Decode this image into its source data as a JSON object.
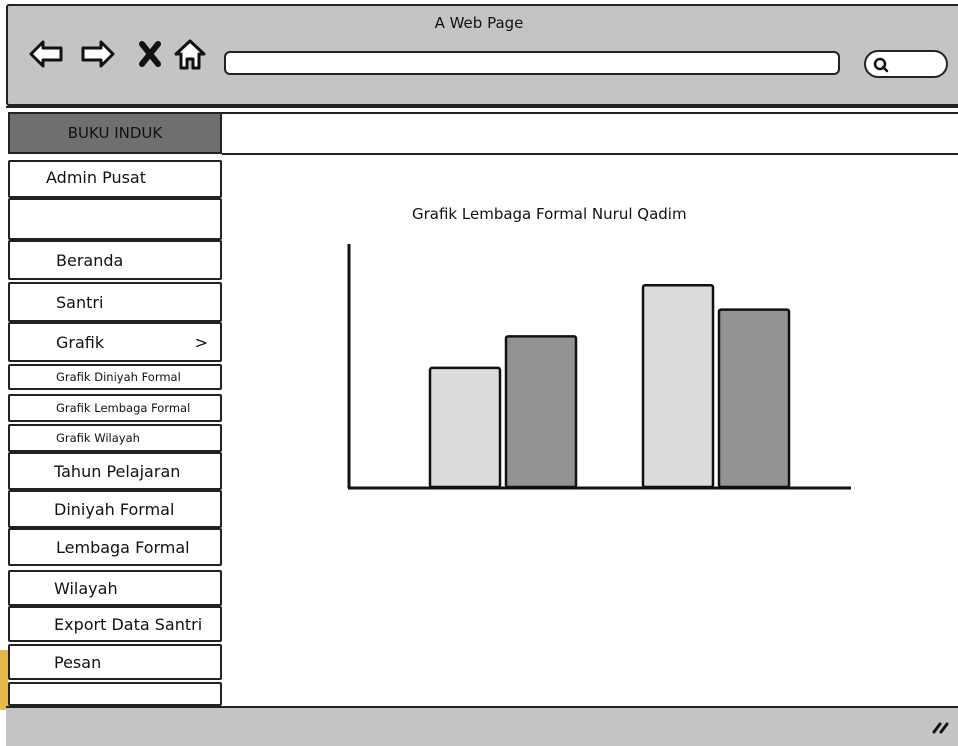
{
  "browser": {
    "title": "A Web Page",
    "nav_icons": [
      "back-arrow-icon",
      "forward-arrow-icon",
      "close-icon",
      "home-icon"
    ],
    "search_icon": "search-icon"
  },
  "brand": {
    "label": "BUKU INDUK"
  },
  "user": {
    "name": "Admin Pusat"
  },
  "sidebar": {
    "items": [
      {
        "label": "Beranda",
        "size": "normal"
      },
      {
        "label": "Santri",
        "size": "normal"
      },
      {
        "label": "Grafik",
        "size": "normal",
        "suffix": ">"
      },
      {
        "label": "Grafik Diniyah Formal",
        "size": "small"
      },
      {
        "label": "Grafik Lembaga Formal",
        "size": "small"
      },
      {
        "label": "Grafik Wilayah",
        "size": "small"
      },
      {
        "label": "Tahun Pelajaran",
        "size": "normal"
      },
      {
        "label": "Diniyah Formal",
        "size": "normal"
      },
      {
        "label": "Lembaga Formal",
        "size": "normal"
      },
      {
        "label": "Wilayah",
        "size": "normal"
      },
      {
        "label": "Export Data Santri",
        "size": "normal"
      },
      {
        "label": "Pesan",
        "size": "normal"
      }
    ]
  },
  "colors": {
    "chrome": "#c4c4c4",
    "brand": "#6f6f6f",
    "bar_light": "#dcdcdc",
    "bar_dark": "#939393"
  },
  "chart_data": {
    "type": "bar",
    "title": "Grafik Lembaga Formal Nurul Qadim",
    "categories": [
      "",
      ""
    ],
    "series": [
      {
        "values": [
          49,
          83
        ]
      },
      {
        "values": [
          62,
          73
        ]
      }
    ],
    "ylim": [
      0,
      100
    ],
    "grid": false
  }
}
